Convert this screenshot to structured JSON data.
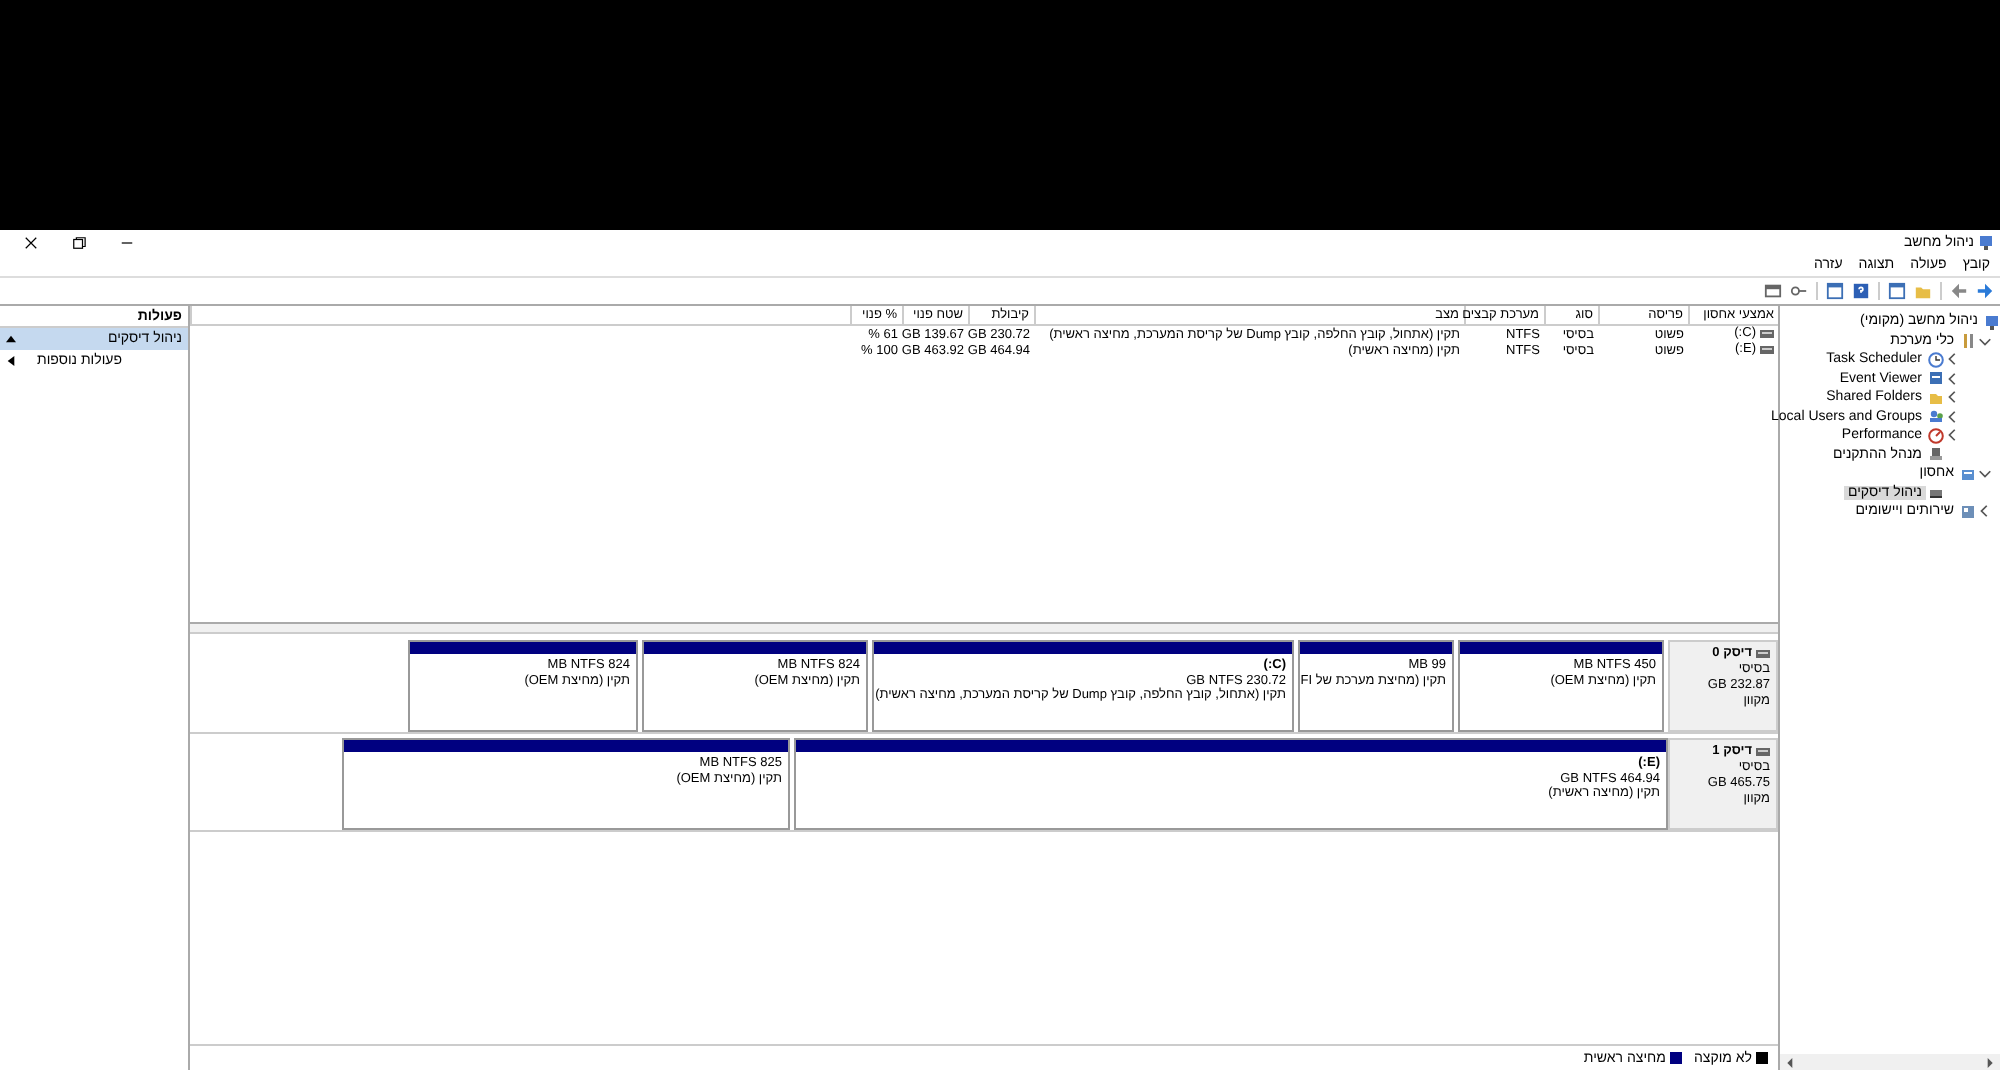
{
  "window": {
    "title": "ניהול מחשב"
  },
  "menu": [
    "קובץ",
    "פעולה",
    "תצוגה",
    "עזרה"
  ],
  "tree": [
    {
      "label": "ניהול מחשב (מקומי)",
      "selected": false,
      "children": [
        {
          "label": "כלי מערכת",
          "selected": false,
          "expanded": true,
          "children": [
            {
              "label": "Task Scheduler",
              "selected": false,
              "expanded": false
            },
            {
              "label": "Event Viewer",
              "selected": false,
              "expanded": false
            },
            {
              "label": "Shared Folders",
              "selected": false,
              "expanded": false
            },
            {
              "label": "Local Users and Groups",
              "selected": false,
              "expanded": false
            },
            {
              "label": "Performance",
              "selected": false,
              "expanded": false
            },
            {
              "label": "מנהל ההתקנים",
              "selected": false
            }
          ]
        },
        {
          "label": "אחסון",
          "selected": false,
          "expanded": true,
          "children": [
            {
              "label": "ניהול דיסקים",
              "selected": true
            }
          ]
        },
        {
          "label": "שירותים ויישומים",
          "selected": false,
          "expanded": false
        }
      ]
    }
  ],
  "volumes": {
    "columns": [
      "אמצעי אחסון",
      "פריסה",
      "סוג",
      "מערכת קבצים",
      "מצב",
      "קיבולת",
      "שטח פנוי",
      "% פנוי"
    ],
    "rows": [
      {
        "cells": [
          "(C:)",
          "פשוט",
          "בסיסי",
          "NTFS",
          "תקין (אתחול, קובץ החלפה, קובץ Dump של קריסת המערכת, מחיצה ראשית)",
          "230.72 GB",
          "139.67 GB",
          "61 %"
        ]
      },
      {
        "cells": [
          "(E:)",
          "פשוט",
          "בסיסי",
          "NTFS",
          "תקין (מחיצה ראשית)",
          "464.94 GB",
          "463.92 GB",
          "100 %"
        ]
      }
    ]
  },
  "disks": [
    {
      "name": "דיסק 0",
      "type": "בסיסי",
      "size": "232.87 GB",
      "status": "מקוון",
      "partitions": [
        {
          "lines": [
            "450 MB NTFS",
            "תקין (מחיצת OEM)"
          ]
        },
        {
          "lines": [
            "99 MB",
            "תקין (מחיצת מערכת של FI"
          ]
        },
        {
          "lines": [
            "(C:)",
            "230.72 GB NTFS",
            "תקין (אתחול, קובץ החלפה, קובץ Dump של קריסת המערכת, מחיצה ראשית)"
          ]
        },
        {
          "lines": [
            "824 MB NTFS",
            "תקין (מחיצת OEM)"
          ]
        },
        {
          "lines": [
            "824 MB NTFS",
            "תקין (מחיצת OEM)"
          ]
        }
      ]
    },
    {
      "name": "דיסק 1",
      "type": "בסיסי",
      "size": "465.75 GB",
      "status": "מקוון",
      "partitions": [
        {
          "lines": [
            "(E:)",
            "464.94 GB NTFS",
            "תקין (מחיצה ראשית)"
          ]
        },
        {
          "lines": [
            "825 MB NTFS",
            "תקין (מחיצת OEM)"
          ]
        }
      ]
    }
  ],
  "legend": [
    {
      "label": "לא מוקצה",
      "color": "#000000"
    },
    {
      "label": "מחיצה ראשית",
      "color": "#000080"
    }
  ],
  "actions": {
    "title": "פעולות",
    "items": [
      {
        "label": "ניהול דיסקים",
        "kind": "section",
        "selected": true
      },
      {
        "label": "פעולות נוספות",
        "kind": "submenu",
        "selected": false
      }
    ]
  }
}
